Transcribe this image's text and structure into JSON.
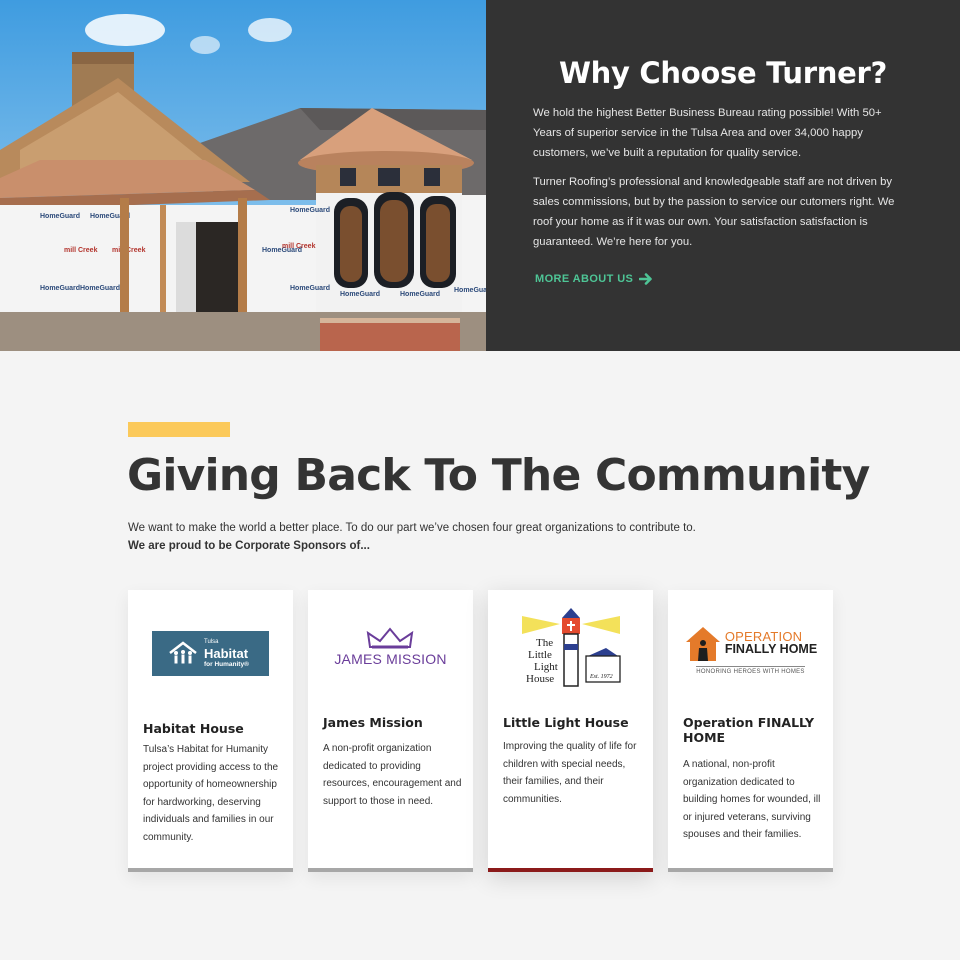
{
  "why": {
    "title": "Why Choose Turner?",
    "paragraph1": "We hold the highest Better Business Bureau rating possible! With 50+ Years of superior service in the Tulsa Area and over 34,000 happy customers, we’ve built a reputation for quality service.",
    "paragraph2": "Turner Roofing’s professional and knowledgeable staff are not driven by sales commissions, but by the passion to service our cutomers right. We roof your home as if it was our own. Your satisfaction satisfaction is guaranteed. We’re here for you.",
    "more_label": "MORE ABOUT US",
    "photo_wrap_brand": "HomeGuard",
    "photo_wrap_brand2": "mill Creek"
  },
  "community": {
    "title": "Giving Back To The Community",
    "intro": "We want to make the world a better place. To do our part we’ve chosen four great organizations to contribute to.",
    "intro_bold": "We are proud to be Corporate Sponsors of...",
    "cards": [
      {
        "title": "Habitat House",
        "description": "Tulsa’s Habitat for Humanity project providing access to the opportunity of homeownership for hardworking, deserving individuals and families in our community.",
        "logo": {
          "line1": "Tulsa",
          "line2": "Habitat",
          "line3": "for Humanity®"
        }
      },
      {
        "title": "James Mission",
        "description": "A non-profit organization dedicated to providing resources, encouragement and support to those in need.",
        "logo": {
          "name": "JAMES MISSION"
        }
      },
      {
        "title": "Little Light House",
        "description": "Improving the quality of life for children with special needs, their families, and their communities.",
        "logo": {
          "line1": "The",
          "line2": "Little",
          "line3": "Light",
          "line4": "House",
          "est": "Est. 1972"
        }
      },
      {
        "title": "Operation FINALLY HOME",
        "description": "A national, non-profit organization dedicated to building homes for wounded, ill or injured veterans, surviving spouses and their families.",
        "logo": {
          "word1": "OPERATION",
          "word2": "FINALLY HOME",
          "sub": "HONORING HEROES WITH HOMES"
        }
      }
    ]
  },
  "colors": {
    "dark_panel": "#333333",
    "accent_green": "#4ec596",
    "accent_yellow": "#fbc95a",
    "active_card_border": "#8b1a1a",
    "card_border": "#a7a7a7"
  },
  "icons": {
    "more": "arrow-right-icon"
  }
}
